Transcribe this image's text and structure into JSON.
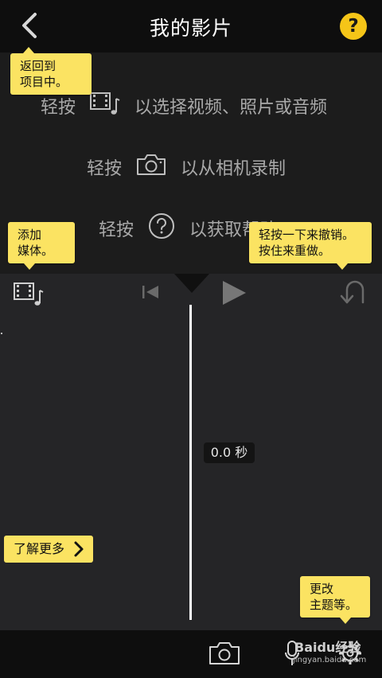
{
  "header": {
    "title": "我的影片",
    "help_label": "?"
  },
  "instructions": [
    {
      "tap": "轻按",
      "text": "以选择视频、照片或音频",
      "icon": "media-icon"
    },
    {
      "tap": "轻按",
      "text": "以从相机录制",
      "icon": "camera-icon"
    },
    {
      "tap": "轻按",
      "text": "以获取帮助",
      "icon": "help-circle-icon"
    }
  ],
  "tooltips": {
    "back": "返回到\n项目中。",
    "add_media": "添加\n媒体。",
    "undo": "轻按一下来撤销。\n按住来重做。",
    "theme": "更改\n主题等。"
  },
  "timeline": {
    "duration": "0.0 秒"
  },
  "learn_more": {
    "label": "了解更多"
  },
  "watermark": {
    "brand": "Baidu经验",
    "url": "jingyan.baidu.com"
  },
  "colors": {
    "accent_yellow": "#f5c518",
    "tooltip_yellow": "#fbe362",
    "background": "#252527",
    "bar": "#0e0e0e"
  }
}
